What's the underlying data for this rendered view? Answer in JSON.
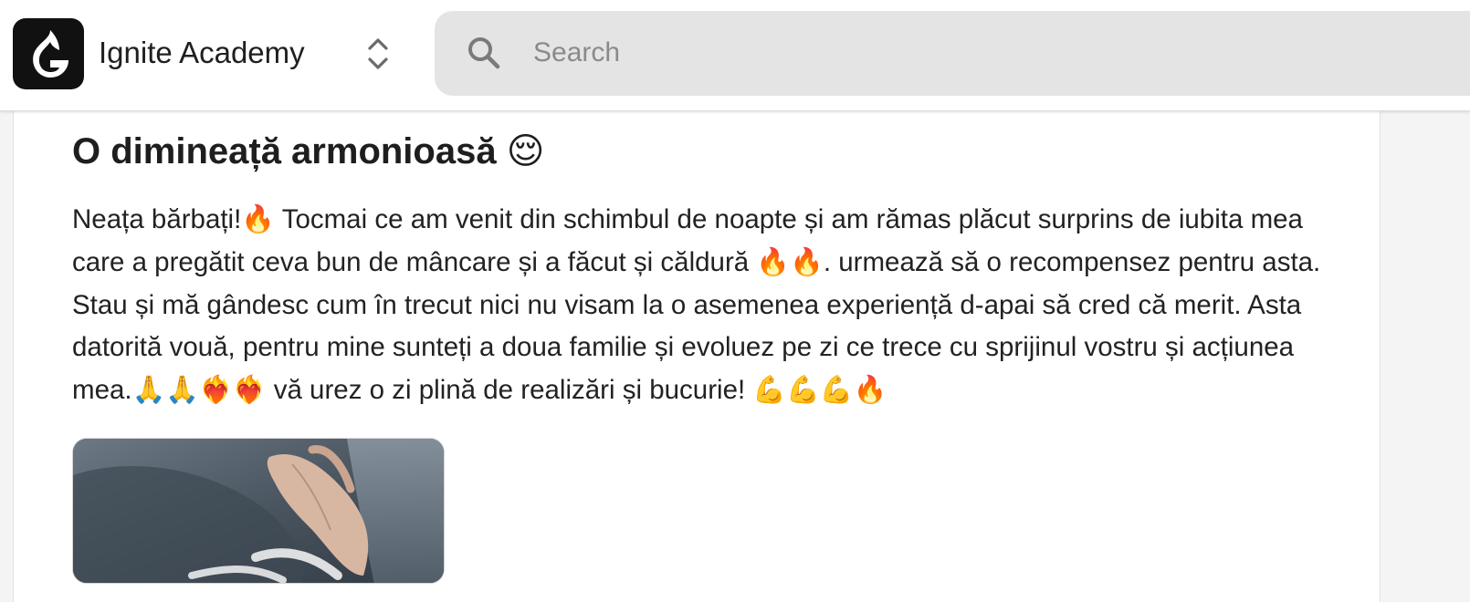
{
  "header": {
    "community_name": "Ignite Academy",
    "logo_icon": "flame-g-logo-icon",
    "switcher_icon": "chevron-up-down-icon"
  },
  "search": {
    "placeholder": "Search",
    "value": "",
    "icon": "search-icon"
  },
  "post": {
    "title": "O dimineață armonioasă 😌",
    "body": "Neața bărbați!🔥 Tocmai ce am venit din schimbul de noapte și am rămas plăcut surprins de iubita mea care a pregătit ceva bun de mâncare și a făcut și căldură 🔥🔥. urmează să o recompensez pentru asta. Stau și mă gândesc cum în trecut nici nu visam la o asemenea experiență d-apai să cred că merit. Asta datorită vouă, pentru mine sunteți a doua familie și evoluez pe zi ce trece cu sprijinul vostru și acțiunea mea.🙏🙏❤️‍🔥❤️‍🔥 vă urez o zi plină de realizări și bucurie! 💪💪💪🔥",
    "image": "post-photo"
  },
  "colors": {
    "topbar_bg": "#ffffff",
    "search_bg": "#e4e4e4",
    "page_bg": "#f4f4f4",
    "logo_bg": "#111111",
    "text": "#222222"
  }
}
